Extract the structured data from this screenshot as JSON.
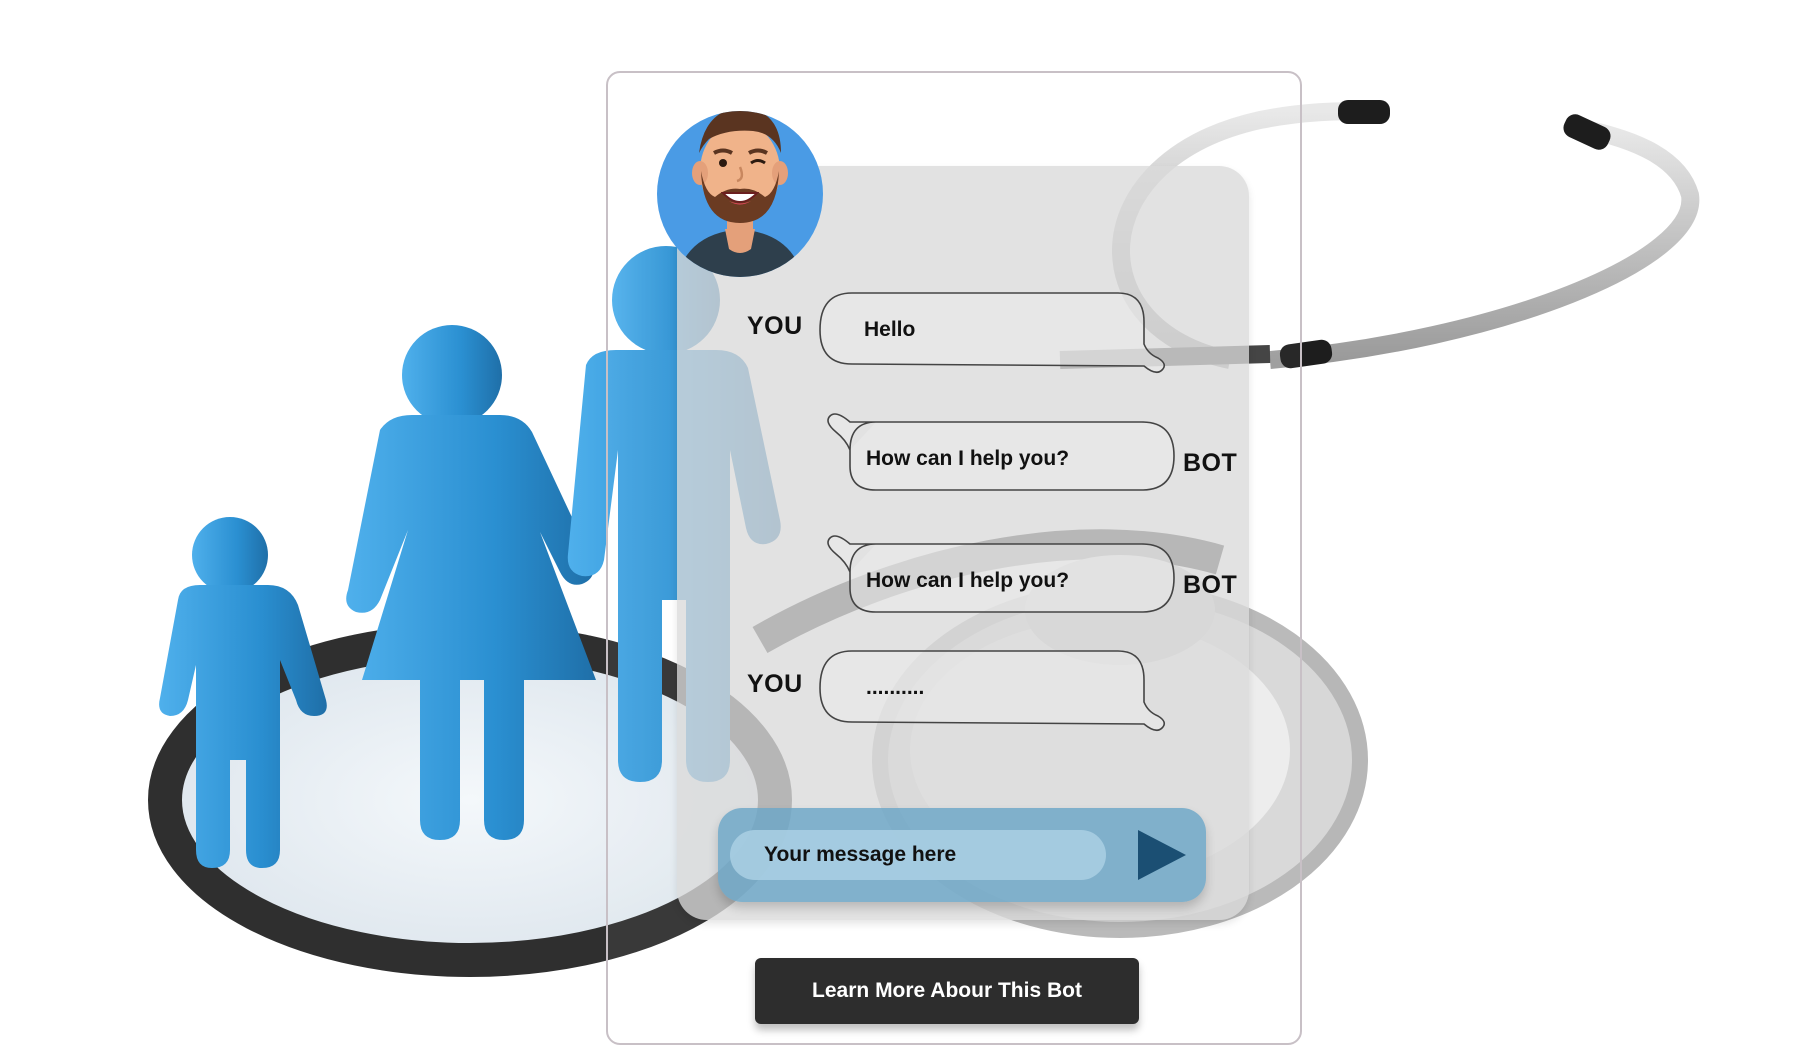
{
  "chat": {
    "messages": [
      {
        "sender": "YOU",
        "text": "Hello"
      },
      {
        "sender": "BOT",
        "text": "How can I help you?"
      },
      {
        "sender": "BOT",
        "text": "How can I help you?"
      },
      {
        "sender": "YOU",
        "text": ".........."
      }
    ]
  },
  "input": {
    "placeholder": "Your message here"
  },
  "icons": {
    "send": "send-icon",
    "avatar": "bot-avatar"
  },
  "cta": {
    "label": "Learn More Abour This Bot"
  },
  "colors": {
    "figure_blue": "#2e8fd3",
    "input_blue": "#6ba6c7",
    "send_arrow": "#1b4f73",
    "avatar_bg": "#4a9be5",
    "button_dark": "#2d2d2d"
  }
}
